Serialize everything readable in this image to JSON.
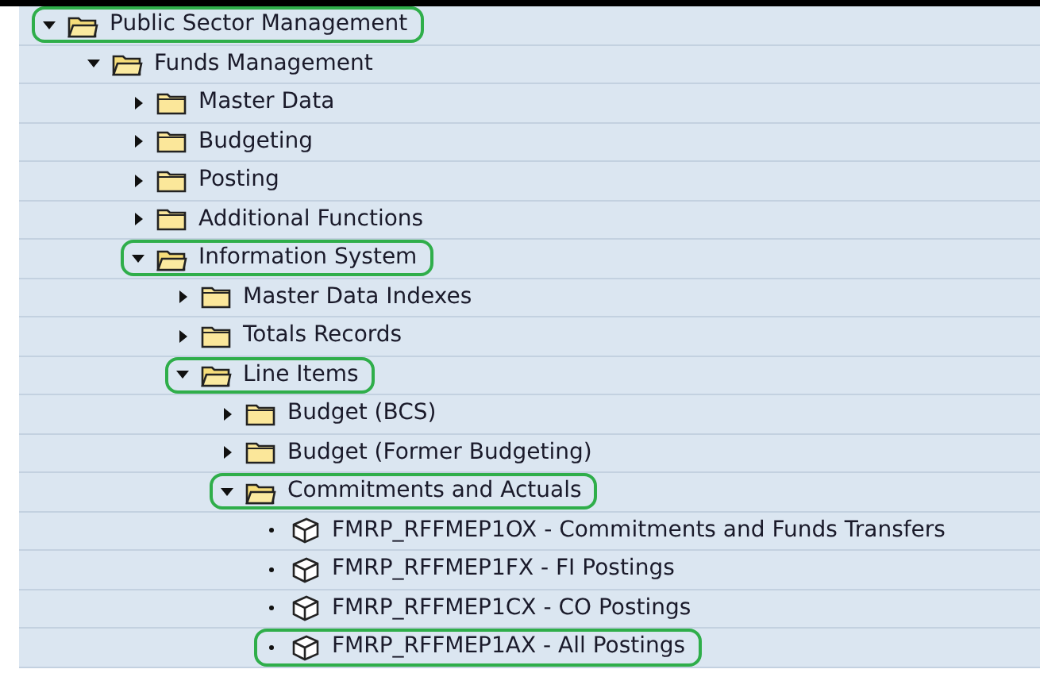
{
  "tree": [
    {
      "kind": "folder",
      "label": "Public Sector Management",
      "expanded": true,
      "highlighted": true,
      "children": [
        {
          "kind": "folder",
          "label": "Funds Management",
          "expanded": true,
          "highlighted": false,
          "children": [
            {
              "kind": "folder",
              "label": "Master Data",
              "expanded": false,
              "highlighted": false
            },
            {
              "kind": "folder",
              "label": "Budgeting",
              "expanded": false,
              "highlighted": false
            },
            {
              "kind": "folder",
              "label": "Posting",
              "expanded": false,
              "highlighted": false
            },
            {
              "kind": "folder",
              "label": "Additional Functions",
              "expanded": false,
              "highlighted": false
            },
            {
              "kind": "folder",
              "label": "Information System",
              "expanded": true,
              "highlighted": true,
              "children": [
                {
                  "kind": "folder",
                  "label": "Master Data Indexes",
                  "expanded": false,
                  "highlighted": false
                },
                {
                  "kind": "folder",
                  "label": "Totals Records",
                  "expanded": false,
                  "highlighted": false
                },
                {
                  "kind": "folder",
                  "label": "Line Items",
                  "expanded": true,
                  "highlighted": true,
                  "children": [
                    {
                      "kind": "folder",
                      "label": "Budget (BCS)",
                      "expanded": false,
                      "highlighted": false
                    },
                    {
                      "kind": "folder",
                      "label": "Budget (Former Budgeting)",
                      "expanded": false,
                      "highlighted": false
                    },
                    {
                      "kind": "folder",
                      "label": "Commitments and Actuals",
                      "expanded": true,
                      "highlighted": true,
                      "children": [
                        {
                          "kind": "report",
                          "label": "FMRP_RFFMEP1OX - Commitments and Funds Transfers",
                          "highlighted": false
                        },
                        {
                          "kind": "report",
                          "label": "FMRP_RFFMEP1FX - FI Postings",
                          "highlighted": false
                        },
                        {
                          "kind": "report",
                          "label": "FMRP_RFFMEP1CX - CO Postings",
                          "highlighted": false
                        },
                        {
                          "kind": "report",
                          "label": "FMRP_RFFMEP1AX - All Postings",
                          "highlighted": true
                        }
                      ]
                    }
                  ]
                }
              ]
            }
          ]
        }
      ]
    }
  ]
}
